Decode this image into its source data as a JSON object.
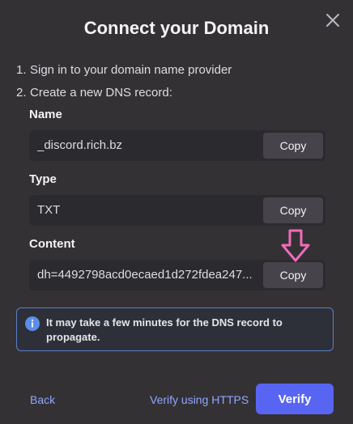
{
  "dialog": {
    "title": "Connect your Domain",
    "close_icon": "close-icon"
  },
  "steps": [
    {
      "num": "1.",
      "text": "Sign in to your domain name provider"
    },
    {
      "num": "2.",
      "text": "Create a new DNS record:"
    }
  ],
  "fields": {
    "name": {
      "label": "Name",
      "value": "_discord.rich.bz",
      "copy_label": "Copy"
    },
    "type": {
      "label": "Type",
      "value": "TXT",
      "copy_label": "Copy"
    },
    "content": {
      "label": "Content",
      "value": "dh=4492798acd0ecaed1d272fdea247...",
      "copy_label": "Copy"
    }
  },
  "annotation": {
    "icon": "pink-down-arrow-icon",
    "color": "#f06bb8"
  },
  "notice": {
    "icon": "info-icon",
    "text": "It may take a few minutes for the DNS record to propagate."
  },
  "footer": {
    "back_label": "Back",
    "verify_https_label": "Verify using HTTPS",
    "verify_label": "Verify"
  },
  "colors": {
    "background": "#343135",
    "accent": "#5865f2",
    "link": "#8fa7ff"
  }
}
